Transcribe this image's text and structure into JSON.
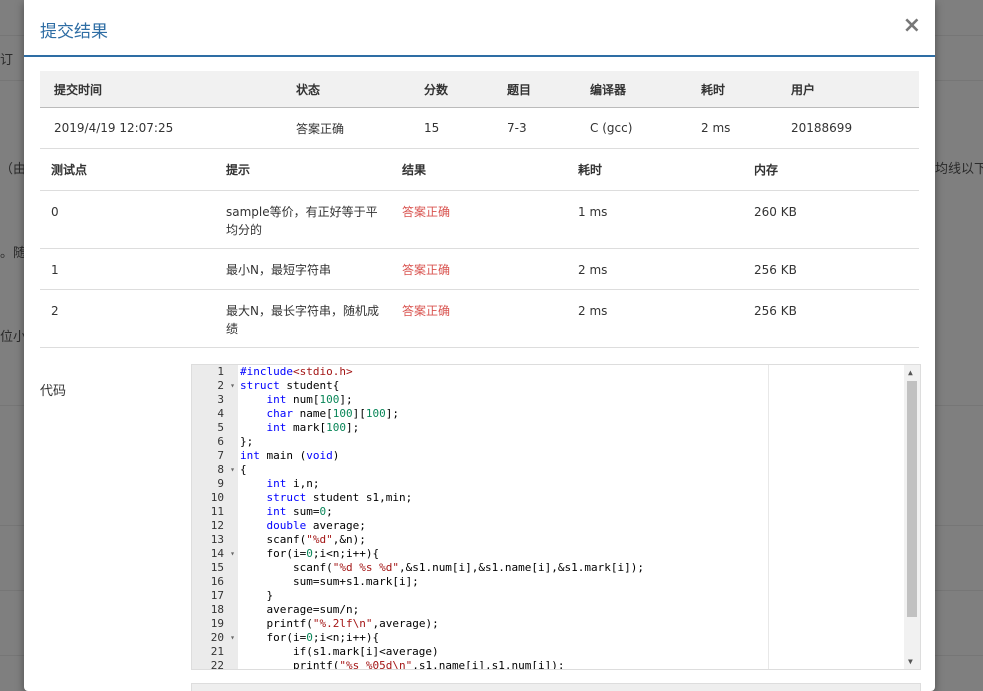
{
  "background": {
    "fragments": [
      "订",
      "（由",
      "。随",
      "位小",
      "均线以下"
    ]
  },
  "modal": {
    "title": "提交结果",
    "close_glyph": "×"
  },
  "summary": {
    "headers": [
      "提交时间",
      "状态",
      "分数",
      "题目",
      "编译器",
      "耗时",
      "用户"
    ],
    "row": {
      "time": "2019/4/19 12:07:25",
      "status": "答案正确",
      "score": "15",
      "problem": "7-3",
      "compiler": "C (gcc)",
      "duration": "2 ms",
      "user": "20188699"
    }
  },
  "cases": {
    "headers": [
      "测试点",
      "提示",
      "结果",
      "耗时",
      "内存"
    ],
    "rows": [
      {
        "id": "0",
        "hint_l1": "sample等价，有正好等于平",
        "hint_l2": "均分的",
        "result": "答案正确",
        "time": "1 ms",
        "memory": "260 KB"
      },
      {
        "id": "1",
        "hint_l1": "最小N，最短字符串",
        "hint_l2": "",
        "result": "答案正确",
        "time": "2 ms",
        "memory": "256 KB"
      },
      {
        "id": "2",
        "hint_l1": "最大N，最长字符串，随机成",
        "hint_l2": "绩",
        "result": "答案正确",
        "time": "2 ms",
        "memory": "256 KB"
      }
    ]
  },
  "code": {
    "label": "代码",
    "line_numbers": [
      "1",
      "2",
      "3",
      "4",
      "5",
      "6",
      "7",
      "8",
      "9",
      "10",
      "11",
      "12",
      "13",
      "14",
      "15",
      "16",
      "17",
      "18",
      "19",
      "20",
      "21",
      "22"
    ],
    "fold_markers": [
      "2",
      "8",
      "14",
      "20"
    ],
    "fold_glyph": "▾",
    "lines": [
      "#include<stdio.h>",
      "struct student{",
      "    int num[100];",
      "    char name[100][100];",
      "    int mark[100];",
      "};",
      "int main (void)",
      "{",
      "    int i,n;",
      "    struct student s1,min;",
      "    int sum=0;",
      "    double average;",
      "    scanf(\"%d\",&n);",
      "    for(i=0;i<n;i++){",
      "        scanf(\"%d %s %d\",&s1.num[i],&s1.name[i],&s1.mark[i]);",
      "        sum=sum+s1.mark[i];",
      "    }",
      "    average=sum/n;",
      "    printf(\"%.2lf\\n\",average);",
      "    for(i=0;i<n;i++){",
      "        if(s1.mark[i]<average)",
      "        printf(\"%s %05d\\n\",s1.name[i],s1.num[i]);"
    ]
  }
}
